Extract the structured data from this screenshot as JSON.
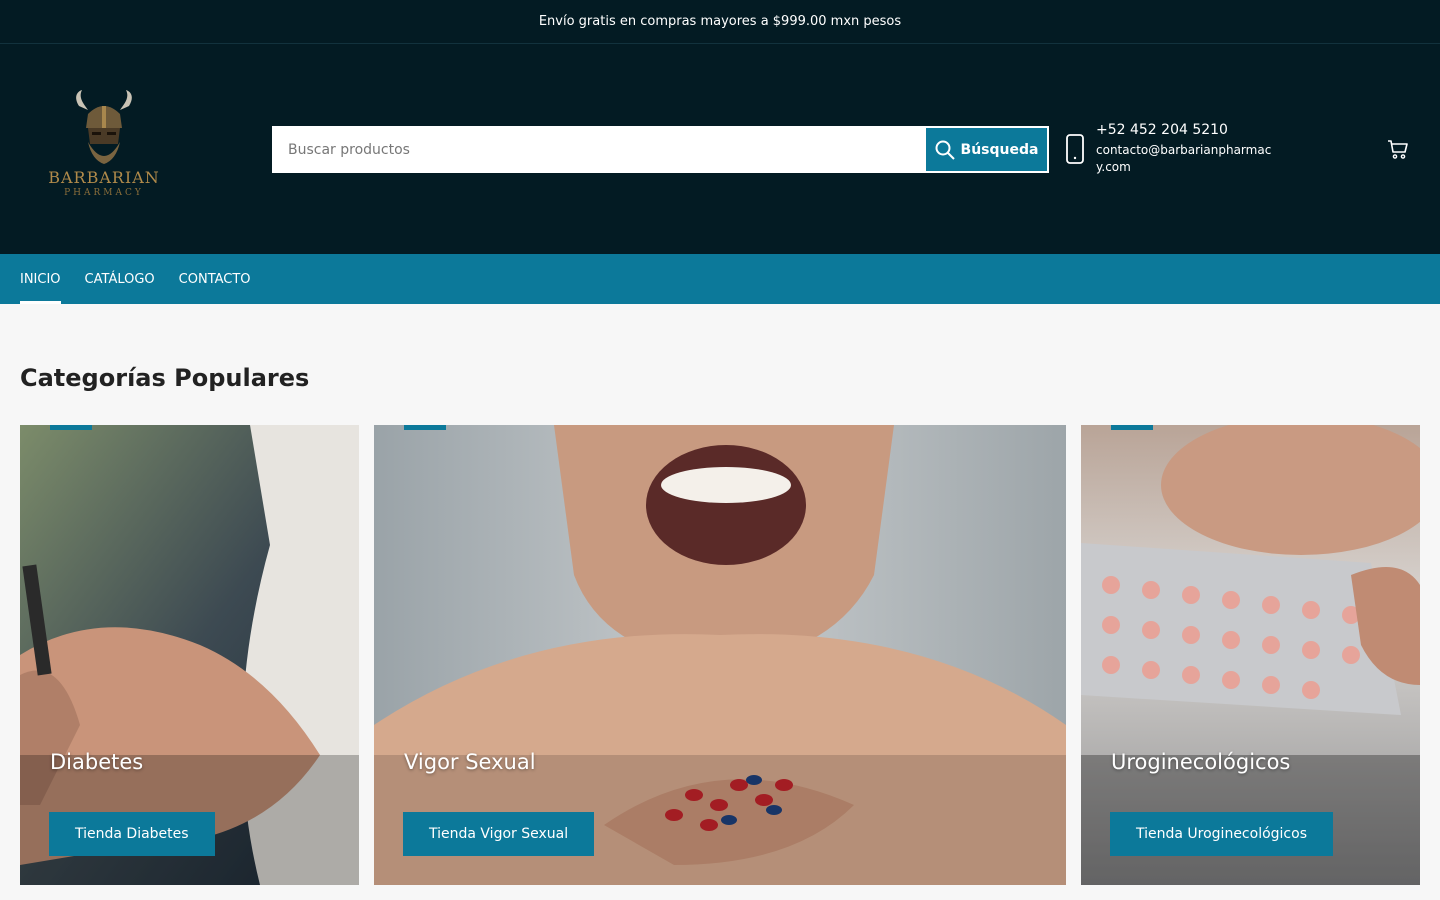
{
  "announcement": "Envío gratis en compras mayores a $999.00 mxn pesos",
  "brand": {
    "name": "BARBARIAN",
    "tagline": "PHARMACY"
  },
  "search": {
    "placeholder": "Buscar productos",
    "button_label": "Búsqueda"
  },
  "contact": {
    "phone": "+52 452 204 5210",
    "email": "contacto@barbarianpharmacy.com"
  },
  "nav": {
    "items": [
      "INICIO",
      "CATÁLOGO",
      "CONTACTO"
    ],
    "active": "INICIO"
  },
  "main": {
    "section_title": "Categorías Populares"
  },
  "categories": [
    {
      "title": "Diabetes",
      "button": "Tienda Diabetes"
    },
    {
      "title": "Vigor Sexual",
      "button": "Tienda Vigor Sexual"
    },
    {
      "title": "Uroginecológicos",
      "button": "Tienda Uroginecológicos"
    }
  ],
  "colors": {
    "header_bg": "#031b23",
    "accent": "#0c799a",
    "page_bg": "#f7f7f7"
  }
}
